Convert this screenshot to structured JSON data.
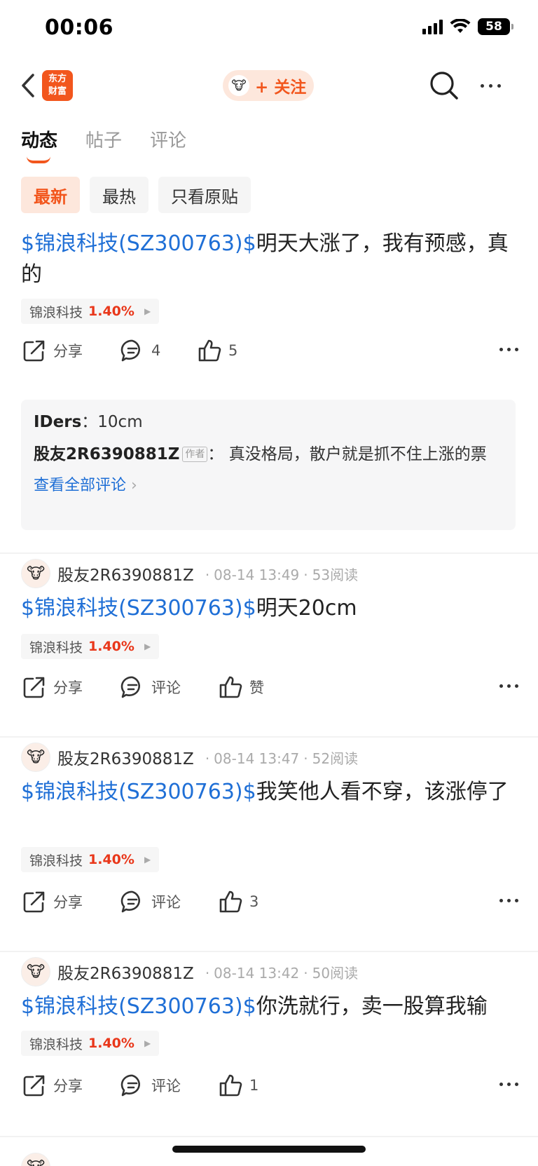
{
  "status": {
    "time": "00:06",
    "battery": "58"
  },
  "nav": {
    "logo_text": "东方\n财富",
    "follow_label": "+ 关注"
  },
  "tabs": [
    {
      "label": "动态"
    },
    {
      "label": "帖子"
    },
    {
      "label": "评论"
    }
  ],
  "filters": [
    {
      "label": "最新"
    },
    {
      "label": "最热"
    },
    {
      "label": "只看原贴"
    }
  ],
  "stock": {
    "link_text": "$锦浪科技(SZ300763)$",
    "name": "锦浪科技",
    "change": "1.40%"
  },
  "posts": [
    {
      "body": "明天大涨了，我有预感，真的",
      "share": "分享",
      "comments": "4",
      "likes": "5",
      "comment_preview": {
        "line1_user": "IDers",
        "line1_text": "10cm",
        "line2_user": "股友2R6390881Z",
        "author_badge": "作者",
        "line2_text": "真没格局，散户就是抓不住上涨的票",
        "view_all": "查看全部评论"
      }
    },
    {
      "author": "股友2R6390881Z",
      "time": "08-14 13:49",
      "reads": "53阅读",
      "body": "明天20cm",
      "share": "分享",
      "comments": "评论",
      "likes": "赞"
    },
    {
      "author": "股友2R6390881Z",
      "time": "08-14 13:47",
      "reads": "52阅读",
      "body": "我笑他人看不穿，该涨停了",
      "share": "分享",
      "comments": "评论",
      "likes": "3"
    },
    {
      "author": "股友2R6390881Z",
      "time": "08-14 13:42",
      "reads": "50阅读",
      "body": "你洗就行，卖一股算我输",
      "share": "分享",
      "comments": "评论",
      "likes": "1"
    }
  ],
  "icons": {
    "back": "chevron-left-icon",
    "search": "search-icon",
    "more": "more-dots-icon",
    "share": "share-icon",
    "comment": "comment-icon",
    "like": "thumbs-up-icon"
  },
  "colors": {
    "accent": "#f2561d",
    "link": "#1f6fd6",
    "rise": "#e9371a"
  }
}
